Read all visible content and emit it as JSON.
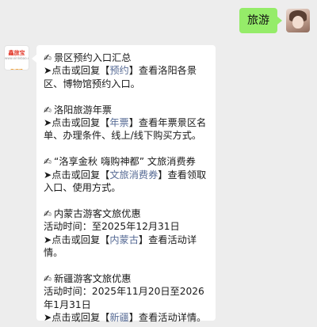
{
  "outgoing": {
    "text": "旅游"
  },
  "bot": {
    "logo_text": "鑫旅宝",
    "logo_subtext": "www.xinlvbao.com",
    "logo_tag": "查询"
  },
  "sections": [
    {
      "title": "景区预约入口汇总",
      "body": [
        {
          "t": "➤点击或回复【"
        },
        {
          "t": "预约",
          "link": true
        },
        {
          "t": "】查看洛阳各景区、博物馆预约入口。"
        }
      ]
    },
    {
      "title": "洛阳旅游年票",
      "body": [
        {
          "t": "➤点击或回复【"
        },
        {
          "t": "年票",
          "link": true
        },
        {
          "t": "】查看年票景区名单、办理条件、线上/线下购买方式。"
        }
      ]
    },
    {
      "title": "“洛享金秋 嗨购神都” 文旅消费券",
      "body": [
        {
          "t": "➤点击或回复【"
        },
        {
          "t": "文旅消费券",
          "link": true
        },
        {
          "t": "】查看领取入口、使用方式。"
        }
      ]
    },
    {
      "title": "内蒙古游客文旅优惠",
      "period": "活动时间：至2025年12月31日",
      "body": [
        {
          "t": "➤点击或回复【"
        },
        {
          "t": "内蒙古",
          "link": true
        },
        {
          "t": "】查看活动详情。"
        }
      ]
    },
    {
      "title": "新疆游客文旅优惠",
      "period": "活动时间：2025年11月20日至2026年1月31日",
      "body": [
        {
          "t": "➤点击或回复【"
        },
        {
          "t": "新疆",
          "link": true
        },
        {
          "t": "】查看活动详情。"
        }
      ]
    }
  ]
}
